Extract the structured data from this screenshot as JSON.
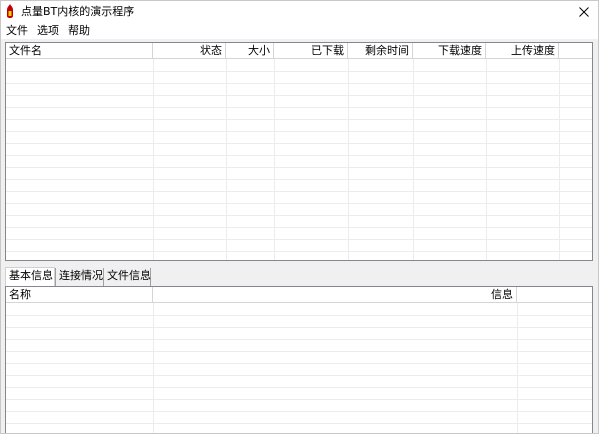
{
  "window": {
    "title": "点量BT内核的演示程序",
    "close_glyph": "✕"
  },
  "menu": {
    "items": [
      "文件",
      "选项",
      "帮助"
    ]
  },
  "torrent_list": {
    "columns": [
      "文件名",
      "状态",
      "大小",
      "已下载",
      "剩余时间",
      "下载速度",
      "上传速度"
    ],
    "rows": []
  },
  "detail_tabs": {
    "tabs": [
      "基本信息",
      "连接情况",
      "文件信息"
    ],
    "active": "基本信息"
  },
  "info_list": {
    "columns": [
      "名称",
      "信息"
    ],
    "rows": []
  },
  "colors": {
    "border": "#828790",
    "grid": "#ececec",
    "header_divider": "#d5d5d5",
    "icon_red": "#c00000"
  },
  "icons": {
    "app": "bt-flame-icon",
    "close": "close-icon"
  }
}
